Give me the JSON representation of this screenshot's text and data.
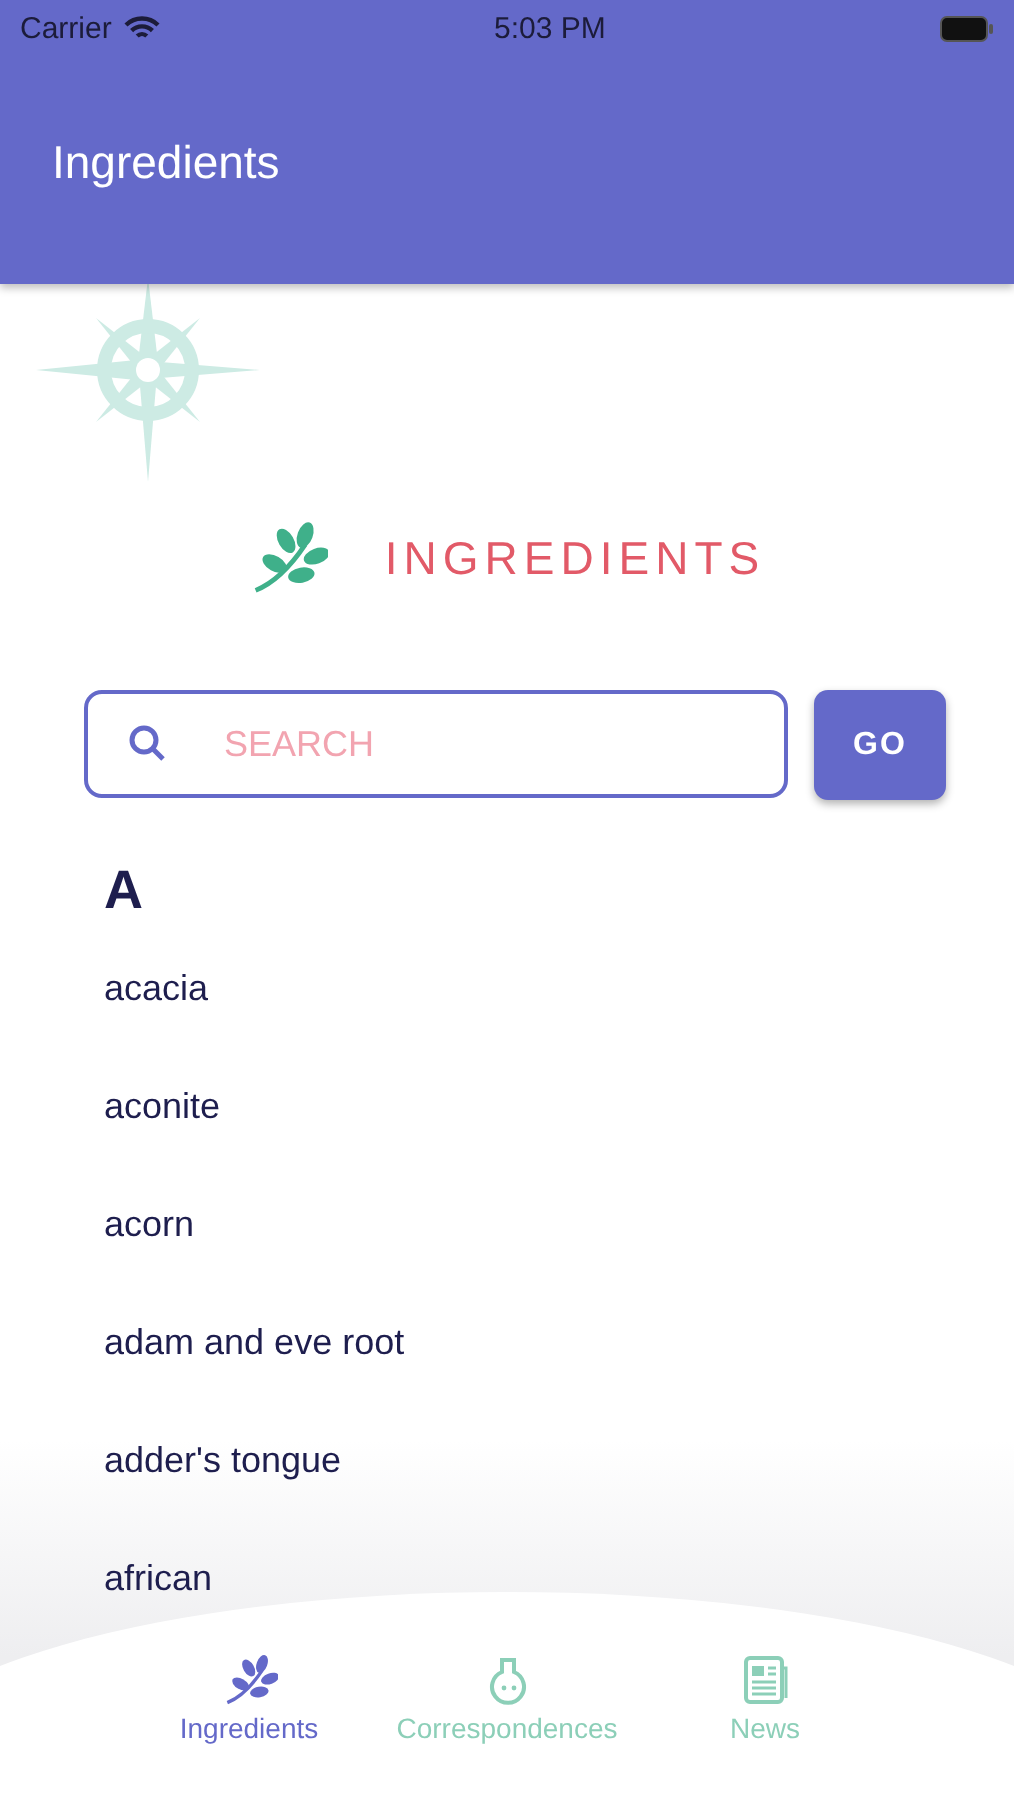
{
  "status_bar": {
    "carrier": "Carrier",
    "time": "5:03 PM"
  },
  "nav_bar": {
    "title": "Ingredients"
  },
  "header": {
    "title": "INGREDIENTS"
  },
  "search": {
    "placeholder": "SEARCH",
    "button": "GO"
  },
  "section": {
    "letter": "A"
  },
  "items": [
    "acacia",
    "aconite",
    "acorn",
    "adam and eve root",
    "adder's tongue",
    "african"
  ],
  "tabs": [
    {
      "label": "Ingredients",
      "kind": "leaf",
      "selected": true
    },
    {
      "label": "Correspondences",
      "kind": "flask",
      "selected": false
    },
    {
      "label": "News",
      "kind": "news",
      "selected": false
    }
  ]
}
